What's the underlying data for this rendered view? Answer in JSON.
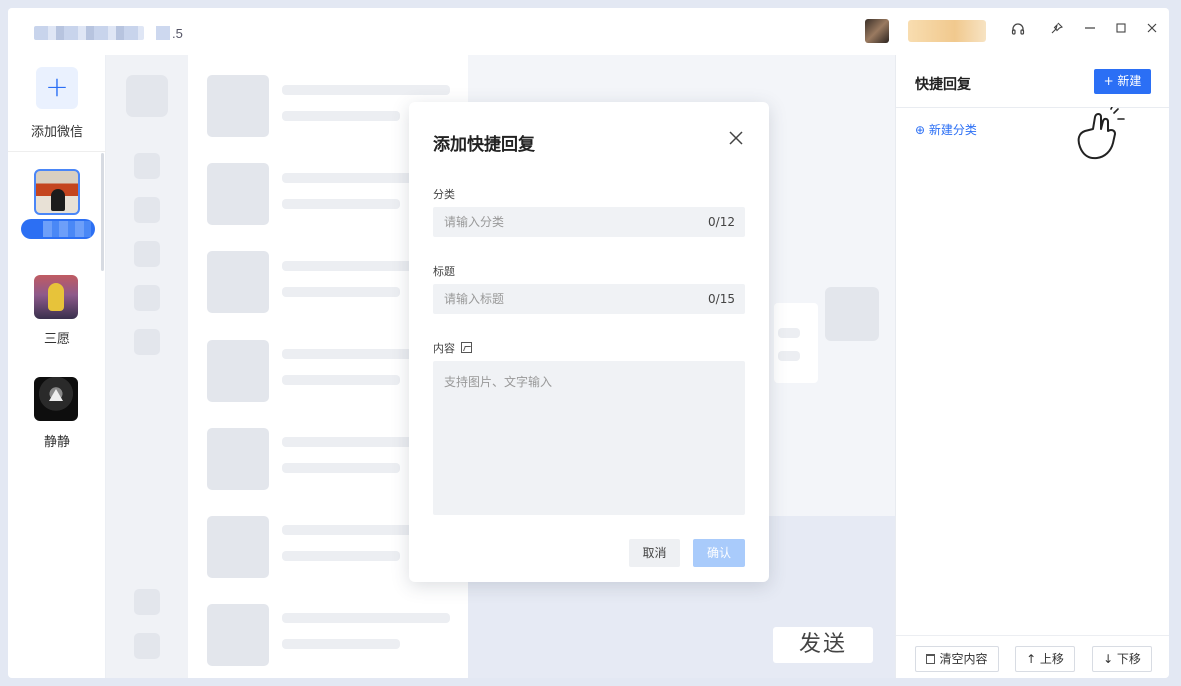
{
  "window": {
    "title_suffix": ".5",
    "controls": [
      "headset-icon",
      "pin-icon",
      "minimize-icon",
      "maximize-icon",
      "close-icon"
    ]
  },
  "accounts": {
    "add_label": "添加微信",
    "items": [
      {
        "name": "",
        "selected": true
      },
      {
        "name": "三愿",
        "selected": false
      },
      {
        "name": "静静",
        "selected": false
      }
    ]
  },
  "chat": {
    "send_label": "发送"
  },
  "quick_reply_panel": {
    "title": "快捷回复",
    "new_button": "+ 新建",
    "new_category": "⊕ 新建分类",
    "footer": {
      "clear_label": "清空内容",
      "move_up_label": "↑ 上移",
      "move_down_label": "↓ 下移"
    }
  },
  "modal": {
    "title": "添加快捷回复",
    "category": {
      "label": "分类",
      "placeholder": "请输入分类",
      "count": "0/12"
    },
    "title_field": {
      "label": "标题",
      "placeholder": "请输入标题",
      "count": "0/15"
    },
    "content": {
      "label": "内容",
      "placeholder": "支持图片、文字输入"
    },
    "cancel_label": "取消",
    "confirm_label": "确认"
  },
  "colors": {
    "accent": "#2b6ff5",
    "confirm_disabled": "#a9cbfb"
  }
}
